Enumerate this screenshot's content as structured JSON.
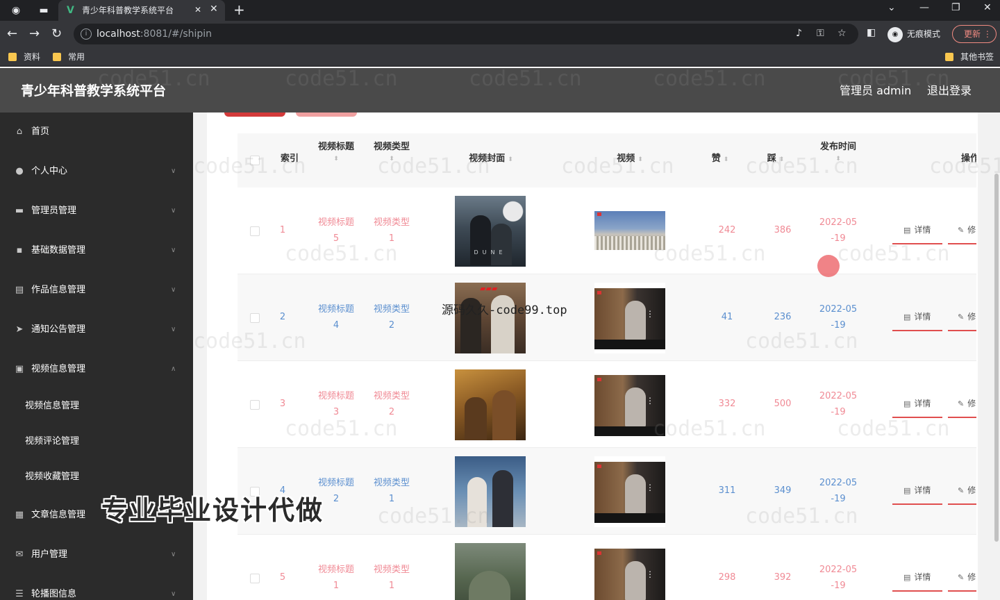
{
  "browser": {
    "tab_title": "青少年科普教学系统平台",
    "url_host": "localhost",
    "url_rest": ":8081/#/shipin",
    "incognito_label": "无痕模式",
    "update_label": "更新",
    "bookmarks": [
      "资料",
      "常用"
    ],
    "other_bookmarks": "其他书签"
  },
  "header": {
    "title": "青少年科普教学系统平台",
    "admin_label": "管理员 admin",
    "logout_label": "退出登录"
  },
  "sidebar": {
    "items": [
      {
        "label": "首页",
        "icon": "home-icon"
      },
      {
        "label": "个人中心",
        "icon": "user-icon"
      },
      {
        "label": "管理员管理",
        "icon": "folder-icon"
      },
      {
        "label": "基础数据管理",
        "icon": "database-icon"
      },
      {
        "label": "作品信息管理",
        "icon": "chat-icon"
      },
      {
        "label": "通知公告管理",
        "icon": "send-icon"
      },
      {
        "label": "视频信息管理",
        "icon": "video-icon"
      },
      {
        "label": "文章信息管理",
        "icon": "document-icon"
      },
      {
        "label": "用户管理",
        "icon": "mail-icon"
      },
      {
        "label": "轮播图信息",
        "icon": "list-icon"
      }
    ],
    "subitems": [
      "视频信息管理",
      "视频评论管理",
      "视频收藏管理"
    ]
  },
  "table": {
    "headers": {
      "index": "索引",
      "title": "视频标题",
      "type": "视频类型",
      "cover": "视频封面",
      "video": "视频",
      "likes": "赞",
      "dislikes": "踩",
      "time": "发布时间",
      "ops": "操作"
    },
    "rows": [
      {
        "index": "1",
        "title_a": "视频标题",
        "title_b": "5",
        "type_a": "视频类型",
        "type_b": "1",
        "likes": "242",
        "dislikes": "386",
        "date_a": "2022-05",
        "date_b": "-19",
        "tone": "pink"
      },
      {
        "index": "2",
        "title_a": "视频标题",
        "title_b": "4",
        "type_a": "视频类型",
        "type_b": "2",
        "likes": "41",
        "dislikes": "236",
        "date_a": "2022-05",
        "date_b": "-19",
        "tone": "blue"
      },
      {
        "index": "3",
        "title_a": "视频标题",
        "title_b": "3",
        "type_a": "视频类型",
        "type_b": "2",
        "likes": "332",
        "dislikes": "500",
        "date_a": "2022-05",
        "date_b": "-19",
        "tone": "pink"
      },
      {
        "index": "4",
        "title_a": "视频标题",
        "title_b": "2",
        "type_a": "视频类型",
        "type_b": "1",
        "likes": "311",
        "dislikes": "349",
        "date_a": "2022-05",
        "date_b": "-19",
        "tone": "blue"
      },
      {
        "index": "5",
        "title_a": "视频标题",
        "title_b": "1",
        "type_a": "视频类型",
        "type_b": "1",
        "likes": "298",
        "dislikes": "392",
        "date_a": "2022-05",
        "date_b": "-19",
        "tone": "pink"
      }
    ],
    "detail_label": "详情",
    "edit_label": "修"
  },
  "overlay": {
    "watermark": "code51.cn",
    "promo": "专业毕业设计代做",
    "midmark": "源码久久-code99.top"
  }
}
